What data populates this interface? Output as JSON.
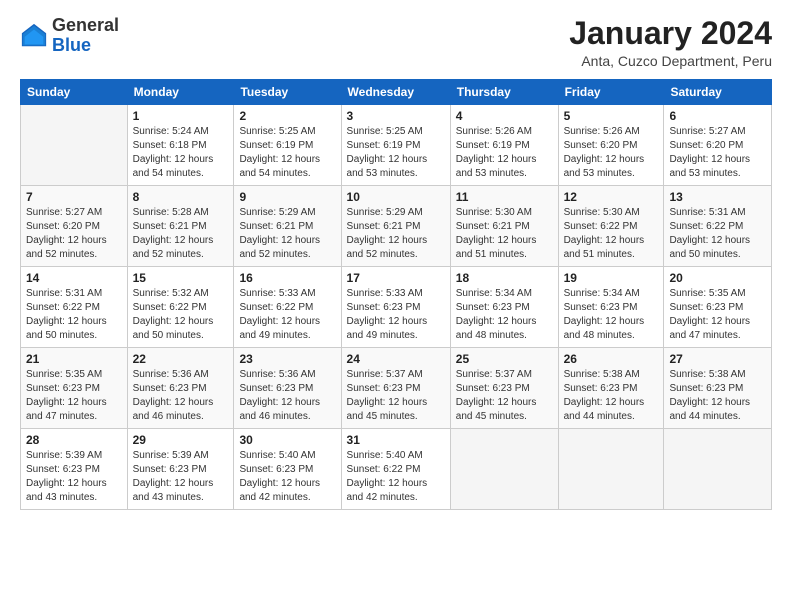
{
  "logo": {
    "general": "General",
    "blue": "Blue"
  },
  "title": "January 2024",
  "subtitle": "Anta, Cuzco Department, Peru",
  "header_days": [
    "Sunday",
    "Monday",
    "Tuesday",
    "Wednesday",
    "Thursday",
    "Friday",
    "Saturday"
  ],
  "weeks": [
    [
      {
        "day": "",
        "sunrise": "",
        "sunset": "",
        "daylight": ""
      },
      {
        "day": "1",
        "sunrise": "Sunrise: 5:24 AM",
        "sunset": "Sunset: 6:18 PM",
        "daylight": "Daylight: 12 hours and 54 minutes."
      },
      {
        "day": "2",
        "sunrise": "Sunrise: 5:25 AM",
        "sunset": "Sunset: 6:19 PM",
        "daylight": "Daylight: 12 hours and 54 minutes."
      },
      {
        "day": "3",
        "sunrise": "Sunrise: 5:25 AM",
        "sunset": "Sunset: 6:19 PM",
        "daylight": "Daylight: 12 hours and 53 minutes."
      },
      {
        "day": "4",
        "sunrise": "Sunrise: 5:26 AM",
        "sunset": "Sunset: 6:19 PM",
        "daylight": "Daylight: 12 hours and 53 minutes."
      },
      {
        "day": "5",
        "sunrise": "Sunrise: 5:26 AM",
        "sunset": "Sunset: 6:20 PM",
        "daylight": "Daylight: 12 hours and 53 minutes."
      },
      {
        "day": "6",
        "sunrise": "Sunrise: 5:27 AM",
        "sunset": "Sunset: 6:20 PM",
        "daylight": "Daylight: 12 hours and 53 minutes."
      }
    ],
    [
      {
        "day": "7",
        "sunrise": "Sunrise: 5:27 AM",
        "sunset": "Sunset: 6:20 PM",
        "daylight": "Daylight: 12 hours and 52 minutes."
      },
      {
        "day": "8",
        "sunrise": "Sunrise: 5:28 AM",
        "sunset": "Sunset: 6:21 PM",
        "daylight": "Daylight: 12 hours and 52 minutes."
      },
      {
        "day": "9",
        "sunrise": "Sunrise: 5:29 AM",
        "sunset": "Sunset: 6:21 PM",
        "daylight": "Daylight: 12 hours and 52 minutes."
      },
      {
        "day": "10",
        "sunrise": "Sunrise: 5:29 AM",
        "sunset": "Sunset: 6:21 PM",
        "daylight": "Daylight: 12 hours and 52 minutes."
      },
      {
        "day": "11",
        "sunrise": "Sunrise: 5:30 AM",
        "sunset": "Sunset: 6:21 PM",
        "daylight": "Daylight: 12 hours and 51 minutes."
      },
      {
        "day": "12",
        "sunrise": "Sunrise: 5:30 AM",
        "sunset": "Sunset: 6:22 PM",
        "daylight": "Daylight: 12 hours and 51 minutes."
      },
      {
        "day": "13",
        "sunrise": "Sunrise: 5:31 AM",
        "sunset": "Sunset: 6:22 PM",
        "daylight": "Daylight: 12 hours and 50 minutes."
      }
    ],
    [
      {
        "day": "14",
        "sunrise": "Sunrise: 5:31 AM",
        "sunset": "Sunset: 6:22 PM",
        "daylight": "Daylight: 12 hours and 50 minutes."
      },
      {
        "day": "15",
        "sunrise": "Sunrise: 5:32 AM",
        "sunset": "Sunset: 6:22 PM",
        "daylight": "Daylight: 12 hours and 50 minutes."
      },
      {
        "day": "16",
        "sunrise": "Sunrise: 5:33 AM",
        "sunset": "Sunset: 6:22 PM",
        "daylight": "Daylight: 12 hours and 49 minutes."
      },
      {
        "day": "17",
        "sunrise": "Sunrise: 5:33 AM",
        "sunset": "Sunset: 6:23 PM",
        "daylight": "Daylight: 12 hours and 49 minutes."
      },
      {
        "day": "18",
        "sunrise": "Sunrise: 5:34 AM",
        "sunset": "Sunset: 6:23 PM",
        "daylight": "Daylight: 12 hours and 48 minutes."
      },
      {
        "day": "19",
        "sunrise": "Sunrise: 5:34 AM",
        "sunset": "Sunset: 6:23 PM",
        "daylight": "Daylight: 12 hours and 48 minutes."
      },
      {
        "day": "20",
        "sunrise": "Sunrise: 5:35 AM",
        "sunset": "Sunset: 6:23 PM",
        "daylight": "Daylight: 12 hours and 47 minutes."
      }
    ],
    [
      {
        "day": "21",
        "sunrise": "Sunrise: 5:35 AM",
        "sunset": "Sunset: 6:23 PM",
        "daylight": "Daylight: 12 hours and 47 minutes."
      },
      {
        "day": "22",
        "sunrise": "Sunrise: 5:36 AM",
        "sunset": "Sunset: 6:23 PM",
        "daylight": "Daylight: 12 hours and 46 minutes."
      },
      {
        "day": "23",
        "sunrise": "Sunrise: 5:36 AM",
        "sunset": "Sunset: 6:23 PM",
        "daylight": "Daylight: 12 hours and 46 minutes."
      },
      {
        "day": "24",
        "sunrise": "Sunrise: 5:37 AM",
        "sunset": "Sunset: 6:23 PM",
        "daylight": "Daylight: 12 hours and 45 minutes."
      },
      {
        "day": "25",
        "sunrise": "Sunrise: 5:37 AM",
        "sunset": "Sunset: 6:23 PM",
        "daylight": "Daylight: 12 hours and 45 minutes."
      },
      {
        "day": "26",
        "sunrise": "Sunrise: 5:38 AM",
        "sunset": "Sunset: 6:23 PM",
        "daylight": "Daylight: 12 hours and 44 minutes."
      },
      {
        "day": "27",
        "sunrise": "Sunrise: 5:38 AM",
        "sunset": "Sunset: 6:23 PM",
        "daylight": "Daylight: 12 hours and 44 minutes."
      }
    ],
    [
      {
        "day": "28",
        "sunrise": "Sunrise: 5:39 AM",
        "sunset": "Sunset: 6:23 PM",
        "daylight": "Daylight: 12 hours and 43 minutes."
      },
      {
        "day": "29",
        "sunrise": "Sunrise: 5:39 AM",
        "sunset": "Sunset: 6:23 PM",
        "daylight": "Daylight: 12 hours and 43 minutes."
      },
      {
        "day": "30",
        "sunrise": "Sunrise: 5:40 AM",
        "sunset": "Sunset: 6:23 PM",
        "daylight": "Daylight: 12 hours and 42 minutes."
      },
      {
        "day": "31",
        "sunrise": "Sunrise: 5:40 AM",
        "sunset": "Sunset: 6:22 PM",
        "daylight": "Daylight: 12 hours and 42 minutes."
      },
      {
        "day": "",
        "sunrise": "",
        "sunset": "",
        "daylight": ""
      },
      {
        "day": "",
        "sunrise": "",
        "sunset": "",
        "daylight": ""
      },
      {
        "day": "",
        "sunrise": "",
        "sunset": "",
        "daylight": ""
      }
    ]
  ]
}
